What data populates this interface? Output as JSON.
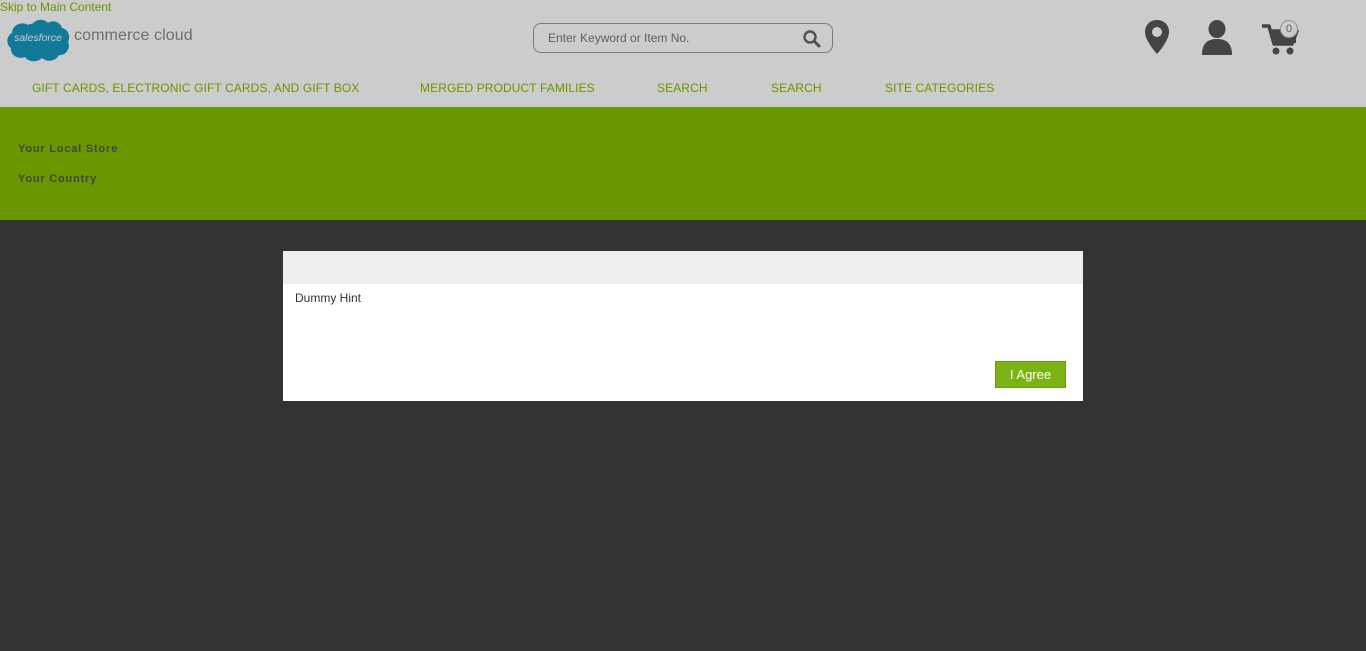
{
  "header": {
    "skip_link": "Skip to Main Content",
    "logo": {
      "cloud_text": "salesforce",
      "text": "commerce cloud"
    },
    "search": {
      "placeholder": "Enter Keyword or Item No."
    },
    "icons": [
      "map-marker-icon",
      "user-icon",
      "cart-icon",
      "search-icon"
    ],
    "cart_count": "0"
  },
  "nav": {
    "items": [
      {
        "label": "GIFT CARDS, ELECTRONIC GIFT CARDS, AND GIFT BOX"
      },
      {
        "label": "MERGED PRODUCT FAMILIES"
      },
      {
        "label": "SEARCH"
      },
      {
        "label": "SEARCH"
      },
      {
        "label": "SITE CATEGORIES"
      }
    ]
  },
  "banner": {
    "store": "Your Local Store",
    "country": "Your Country"
  },
  "modal": {
    "title": "",
    "body": "Dummy Hint",
    "agree_label": "I Agree"
  },
  "colors": {
    "brand_green": "#84bd00",
    "button_green": "#7cb314",
    "overlay": "#333333",
    "salesforce_blue": "#1798c1"
  }
}
